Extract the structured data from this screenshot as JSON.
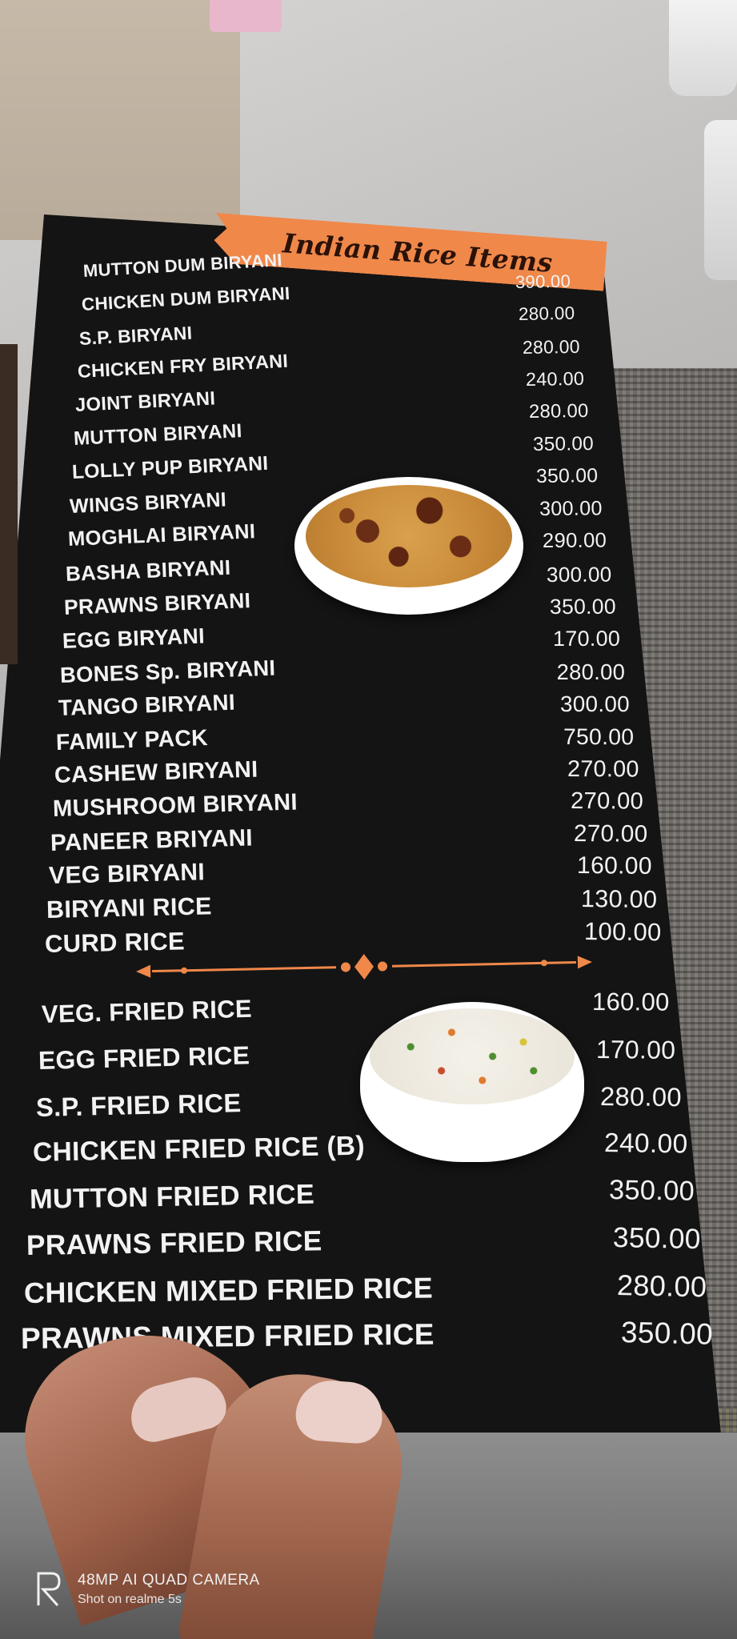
{
  "menu": {
    "title": "Indian Rice Items",
    "biryani_items": [
      {
        "name": "MUTTON DUM BIRYANI",
        "price": "390.00"
      },
      {
        "name": "CHICKEN DUM BIRYANI",
        "price": "280.00"
      },
      {
        "name": "S.P. BIRYANI",
        "price": "280.00"
      },
      {
        "name": "CHICKEN FRY BIRYANI",
        "price": "240.00"
      },
      {
        "name": "JOINT BIRYANI",
        "price": "280.00"
      },
      {
        "name": "MUTTON BIRYANI",
        "price": "350.00"
      },
      {
        "name": "LOLLY PUP BIRYANI",
        "price": "350.00"
      },
      {
        "name": "WINGS BIRYANI",
        "price": "300.00"
      },
      {
        "name": "MOGHLAI BIRYANI",
        "price": "290.00"
      },
      {
        "name": "BASHA BIRYANI",
        "price": "300.00"
      },
      {
        "name": "PRAWNS BIRYANI",
        "price": "350.00"
      },
      {
        "name": "EGG BIRYANI",
        "price": "170.00"
      },
      {
        "name": "BONES Sp. BIRYANI",
        "price": "280.00"
      },
      {
        "name": "TANGO BIRYANI",
        "price": "300.00"
      },
      {
        "name": "FAMILY PACK",
        "price": "750.00"
      },
      {
        "name": "CASHEW BIRYANI",
        "price": "270.00"
      },
      {
        "name": "MUSHROOM BIRYANI",
        "price": "270.00"
      },
      {
        "name": "PANEER BRIYANI",
        "price": "270.00"
      },
      {
        "name": "VEG BIRYANI",
        "price": "160.00"
      },
      {
        "name": "BIRYANI RICE",
        "price": "130.00"
      },
      {
        "name": "CURD RICE",
        "price": "100.00"
      }
    ],
    "fried_rice_items": [
      {
        "name": "VEG. FRIED RICE",
        "price": "160.00"
      },
      {
        "name": "EGG FRIED RICE",
        "price": "170.00"
      },
      {
        "name": "S.P. FRIED RICE",
        "price": "280.00"
      },
      {
        "name": "CHICKEN FRIED RICE (B)",
        "price": "240.00"
      },
      {
        "name": "MUTTON FRIED RICE",
        "price": "350.00"
      },
      {
        "name": "PRAWNS FRIED RICE",
        "price": "350.00"
      },
      {
        "name": "CHICKEN MIXED FRIED RICE",
        "price": "280.00"
      },
      {
        "name": "PRAWNS MIXED FRIED RICE",
        "price": "350.00"
      }
    ]
  },
  "watermark": {
    "line1": "48MP AI QUAD CAMERA",
    "line2": "Shot on realme 5s"
  },
  "colors": {
    "card": "#141414",
    "banner": "#f0884a",
    "text": "#f2f2f2",
    "divider": "#f0884a"
  },
  "icons": {
    "biryani_photo": "biryani-bowl-image",
    "fried_rice_photo": "fried-rice-bowl-image",
    "divider": "ornamental-divider",
    "watermark_logo": "realme-logo"
  }
}
